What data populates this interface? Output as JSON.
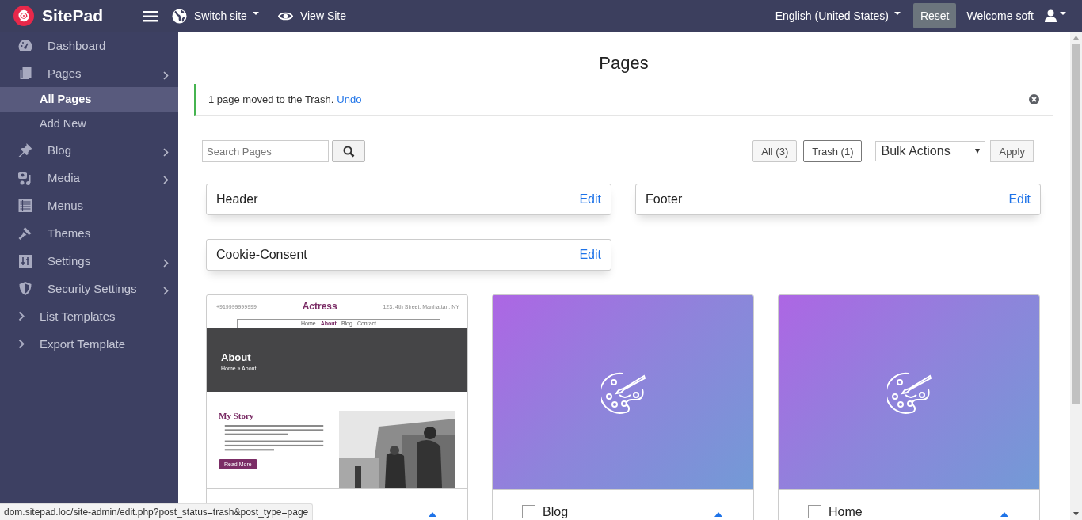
{
  "brand": {
    "name": "SitePad"
  },
  "topbar": {
    "switch_site": "Switch site",
    "view_site": "View Site",
    "language": "English (United States)",
    "reset": "Reset",
    "welcome": "Welcome soft"
  },
  "sidebar": {
    "items": [
      {
        "label": "Dashboard",
        "has_submenu": false
      },
      {
        "label": "Pages",
        "has_submenu": true,
        "expanded": true,
        "children": [
          {
            "label": "All Pages",
            "selected": true
          },
          {
            "label": "Add New",
            "selected": false
          }
        ]
      },
      {
        "label": "Blog",
        "has_submenu": true
      },
      {
        "label": "Media",
        "has_submenu": true
      },
      {
        "label": "Menus",
        "has_submenu": false
      },
      {
        "label": "Themes",
        "has_submenu": false
      },
      {
        "label": "Settings",
        "has_submenu": true
      },
      {
        "label": "Security Settings",
        "has_submenu": true
      },
      {
        "label": "List Templates",
        "has_submenu": false
      },
      {
        "label": "Export Template",
        "has_submenu": false
      }
    ]
  },
  "main": {
    "title": "Pages",
    "notice": {
      "text": "1 page moved to the Trash.",
      "link": "Undo"
    },
    "search": {
      "placeholder": "Search Pages"
    },
    "filters": [
      {
        "label": "All (3)",
        "selected": false
      },
      {
        "label": "Trash (1)",
        "selected": true
      }
    ],
    "bulk_actions": {
      "value": "Bulk Actions",
      "apply": "Apply"
    },
    "sections": [
      {
        "title": "Header",
        "action": "Edit"
      },
      {
        "title": "Footer",
        "action": "Edit"
      },
      {
        "title": "Cookie-Consent",
        "action": "Edit"
      }
    ],
    "pages": [
      {
        "kind": "website",
        "site": {
          "phone": "+919999999999",
          "name": "Actress",
          "address": "123, 4th Street, Manhattan, NY",
          "nav": [
            {
              "label": "Home",
              "selected": false
            },
            {
              "label": "About",
              "selected": true
            },
            {
              "label": "Blog",
              "selected": false
            },
            {
              "label": "Contact",
              "selected": false
            }
          ],
          "heading": "About",
          "breadcrumb": "Home » About",
          "story_title": "My Story",
          "button": "Read More"
        }
      },
      {
        "kind": "placeholder",
        "title": "Blog",
        "checked": false
      },
      {
        "kind": "placeholder",
        "title": "Home",
        "checked": false
      }
    ]
  },
  "status_bar": {
    "url": "dom.sitepad.loc/site-admin/edit.php?post_status=trash&post_type=page"
  }
}
